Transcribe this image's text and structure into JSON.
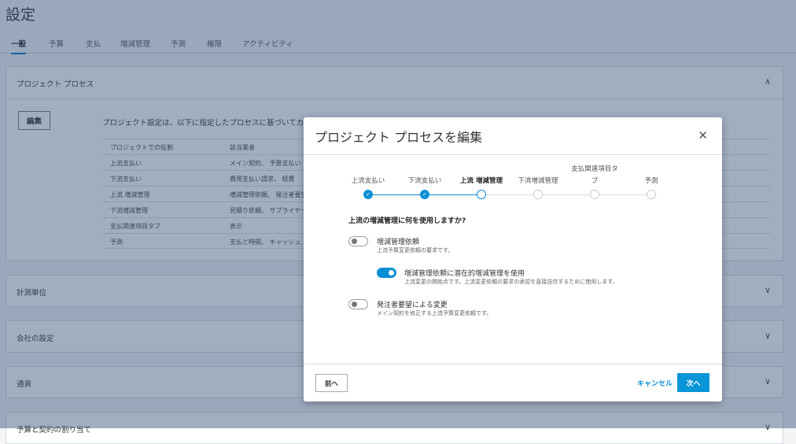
{
  "page": {
    "title": "設定"
  },
  "tabs": [
    "一般",
    "予算",
    "支払",
    "増減管理",
    "予測",
    "権限",
    "アクティビティ"
  ],
  "process_section": {
    "title": "プロジェクト プロセス",
    "edit_label": "編集",
    "description": "プロジェクト設定は、以下に指定したプロセスに基づいてカ",
    "table": {
      "headers": [
        "プロジェクトでの役割",
        "該当業者"
      ],
      "rows": [
        [
          "上流支払い",
          "メイン契約、 予算支払い"
        ],
        [
          "下流支払い",
          "費用支払い請求、 経費"
        ],
        [
          "上流 増減管理",
          "増減管理依頼、 発注者要望"
        ],
        [
          "下流増減管理",
          "見積り依頼、 サプライヤー"
        ],
        [
          "支払関連項目タブ",
          "表示"
        ],
        [
          "予測",
          "支払と時間、 キャッシュ"
        ]
      ]
    }
  },
  "sections": [
    "計測単位",
    "会社の設定",
    "通貨",
    "予算と契約の割り当て"
  ],
  "modal": {
    "title": "プロジェクト プロセスを編集",
    "steps": [
      {
        "label": "上流支払い",
        "state": "done"
      },
      {
        "label": "下流支払い",
        "state": "done"
      },
      {
        "label": "上流 増減管理",
        "state": "current"
      },
      {
        "label": "下流増減管理",
        "state": "todo"
      },
      {
        "label": "支払関連項目タブ",
        "state": "todo"
      },
      {
        "label": "予測",
        "state": "todo"
      }
    ],
    "question": "上流の増減管理に何を使用しますか?",
    "options": [
      {
        "label": "増減管理依頼",
        "sub": "上流予算変更依頼の要求です。",
        "on": false
      },
      {
        "label": "増減管理依頼に潜在的増減管理を使用",
        "sub": "上流変更の開始点です。上流変更依頼の要求の承認を直接送信するために使用します。",
        "on": true
      },
      {
        "label": "発注者要望による変更",
        "sub": "メイン契約を修正する上流予算変更依頼です。",
        "on": false
      }
    ],
    "prev_label": "前へ",
    "cancel_label": "キャンセル",
    "next_label": "次へ"
  }
}
